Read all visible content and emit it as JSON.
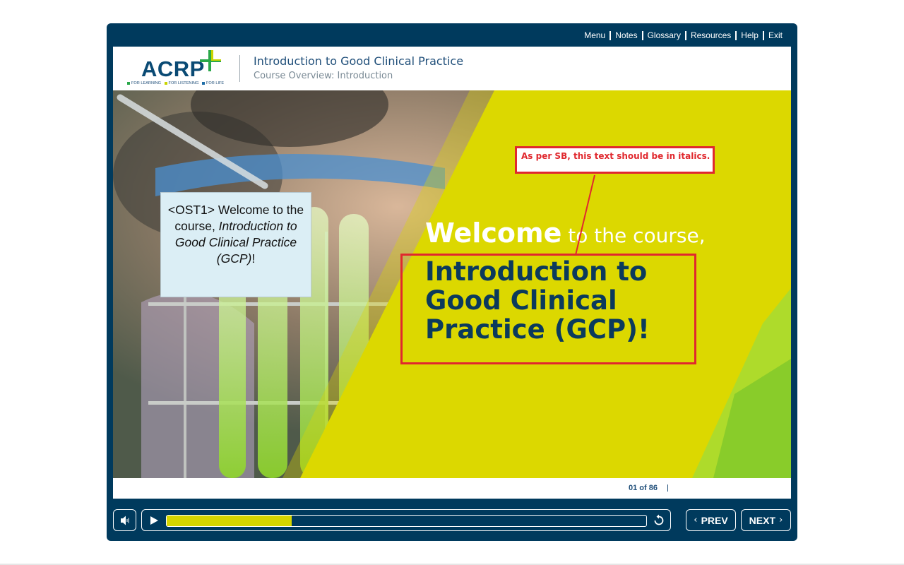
{
  "topnav": {
    "items": [
      "Menu",
      "Notes",
      "Glossary",
      "Resources",
      "Help",
      "Exit"
    ]
  },
  "header": {
    "logo_text": "ACRP",
    "logo_tagline": [
      "FOR LEARNING",
      "FOR LISTENING",
      "FOR LIFE"
    ],
    "course_title": "Introduction to Good Clinical Practice",
    "course_subtitle": "Course Overview: Introduction"
  },
  "slide": {
    "ost_prefix": "<OST1> Welcome to the course, ",
    "ost_italic": "Introduction to Good Clinical Practice (GCP)",
    "ost_suffix": "!",
    "welcome_big": "Welcome",
    "welcome_small": " to the course,",
    "title": "Introduction to Good Clinical Practice (GCP)!",
    "review_note": "As per SB, this text should be in italics."
  },
  "footer": {
    "page_counter": "01 of 86"
  },
  "controls": {
    "prev_label": "PREV",
    "next_label": "NEXT",
    "progress_fraction": 0.26
  },
  "colors": {
    "player_frame": "#003a5d",
    "accent_yellow": "#dcd800",
    "title_navy": "#0b3a5c",
    "review_red": "#e0282e",
    "logo_green": "#2aa84a"
  },
  "icons": [
    "audio-icon",
    "play-icon",
    "replay-icon",
    "chevron-left-icon",
    "chevron-right-icon"
  ]
}
